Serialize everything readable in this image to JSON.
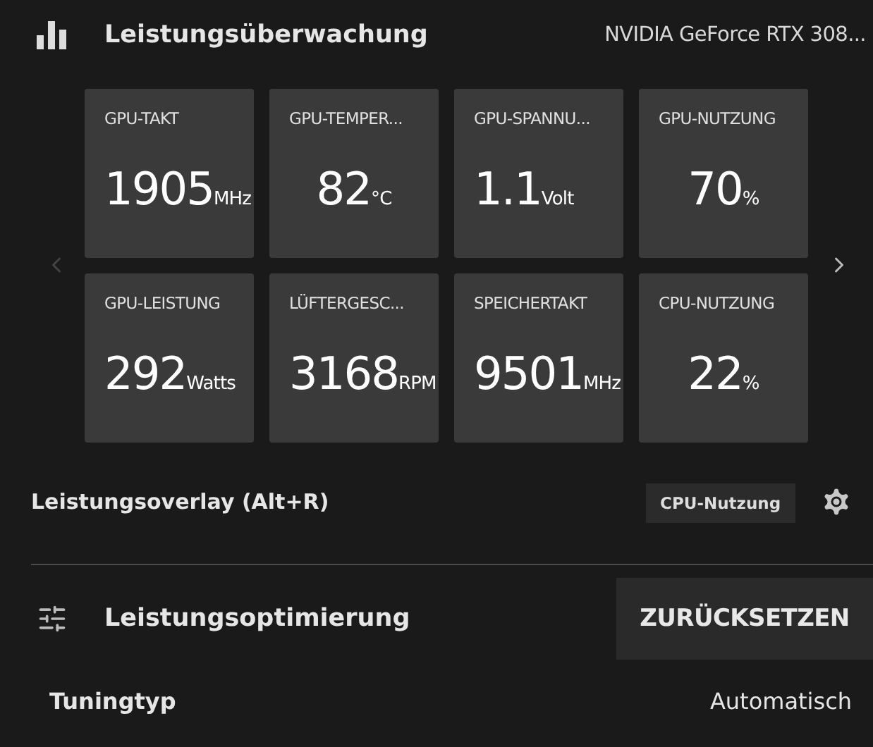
{
  "header": {
    "title": "Leistungsüberwachung",
    "device": "NVIDIA GeForce RTX 308..."
  },
  "metrics": [
    {
      "label": "GPU-TAKT",
      "value": "1905",
      "unit": "MHz"
    },
    {
      "label": "GPU-TEMPER...",
      "value": "82",
      "unit": "°C"
    },
    {
      "label": "GPU-SPANNU...",
      "value": "1.1",
      "unit": "Volt"
    },
    {
      "label": "GPU-NUTZUNG",
      "value": "70",
      "unit": "%"
    },
    {
      "label": "GPU-LEISTUNG",
      "value": "292",
      "unit": "Watts"
    },
    {
      "label": "LÜFTERGESC...",
      "value": "3168",
      "unit": "RPM"
    },
    {
      "label": "SPEICHERTAKT",
      "value": "9501",
      "unit": "MHz"
    },
    {
      "label": "CPU-NUTZUNG",
      "value": "22",
      "unit": "%"
    }
  ],
  "overlay": {
    "label": "Leistungsoverlay (Alt+R)",
    "tooltip": "CPU-Nutzung"
  },
  "tuning": {
    "title": "Leistungsoptimierung",
    "reset_button": "ZURÜCKSETZEN",
    "rows": [
      {
        "label": "Tuningtyp",
        "value": "Automatisch"
      }
    ]
  }
}
